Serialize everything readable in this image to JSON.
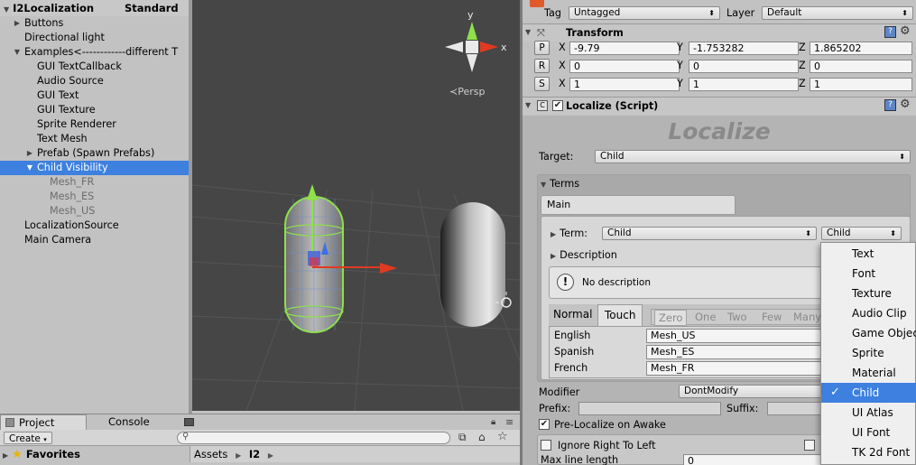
{
  "hierarchy": {
    "root": "I2Localization",
    "root_suffix": "Standard",
    "items": [
      {
        "label": "Buttons",
        "arrow": "▶"
      },
      {
        "label": "Directional light",
        "arrow": ""
      },
      {
        "label": "Examples<------------different T",
        "arrow": "▼"
      },
      {
        "label": "GUI TextCallback",
        "arrow": ""
      },
      {
        "label": "Audio Source",
        "arrow": ""
      },
      {
        "label": "GUI Text",
        "arrow": ""
      },
      {
        "label": "GUI Texture",
        "arrow": ""
      },
      {
        "label": "Sprite Renderer",
        "arrow": ""
      },
      {
        "label": "Text Mesh",
        "arrow": ""
      },
      {
        "label": "Prefab (Spawn Prefabs)",
        "arrow": "▶"
      },
      {
        "label": "Child Visibility",
        "arrow": "▼"
      },
      {
        "label": "Mesh_FR",
        "arrow": ""
      },
      {
        "label": "Mesh_ES",
        "arrow": ""
      },
      {
        "label": "Mesh_US",
        "arrow": ""
      },
      {
        "label": "LocalizationSource",
        "arrow": ""
      },
      {
        "label": "Main Camera",
        "arrow": ""
      }
    ]
  },
  "scene": {
    "persp_label": "≺Persp",
    "axis_y": "y",
    "axis_x": "x"
  },
  "bottom": {
    "tab_project": "Project",
    "tab_console": "Console",
    "create_label": "Create",
    "favorites_label": "Favorites",
    "breadcrumb_root": "Assets",
    "breadcrumb_child": "I2"
  },
  "inspector": {
    "tag_label": "Tag",
    "tag_value": "Untagged",
    "layer_label": "Layer",
    "layer_value": "Default",
    "transform_title": "Transform",
    "position": {
      "btn": "P",
      "x": "-9.79",
      "y": "-1.753282",
      "z": "1.865202"
    },
    "rotation": {
      "btn": "R",
      "x": "0",
      "y": "0",
      "z": "0"
    },
    "scale": {
      "btn": "S",
      "x": "1",
      "y": "1",
      "z": "1"
    },
    "axis_x": "X",
    "axis_y": "Y",
    "axis_z": "Z",
    "script_title": "Localize (Script)",
    "localize_heading": "Localize",
    "target_label": "Target:",
    "target_value": "Child",
    "terms_label": "Terms",
    "main_tab": "Main",
    "term_label": "Term:",
    "term_value": "Child",
    "term_type": "Child",
    "description_label": "Description",
    "no_description": "No description",
    "mode_normal": "Normal",
    "mode_touch": "Touch",
    "plurals": [
      "Zero",
      "One",
      "Two",
      "Few",
      "Many"
    ],
    "languages": [
      {
        "lang": "English",
        "value": "Mesh_US"
      },
      {
        "lang": "Spanish",
        "value": "Mesh_ES"
      },
      {
        "lang": "French",
        "value": "Mesh_FR"
      }
    ],
    "modifier_label": "Modifier",
    "modifier_value": "DontModify",
    "prefix_label": "Prefix:",
    "suffix_label": "Suffix:",
    "prelocalize_label": "Pre-Localize on Awake",
    "ignore_rtl_label": "Ignore Right To Left",
    "max_line_label": "Max line length",
    "max_line_value": "0"
  },
  "type_menu": {
    "items": [
      "Text",
      "Font",
      "Texture",
      "Audio Clip",
      "Game Object",
      "Sprite",
      "Material",
      "Child",
      "UI Atlas",
      "UI Font",
      "TK 2d Font"
    ],
    "selected": "Child"
  }
}
